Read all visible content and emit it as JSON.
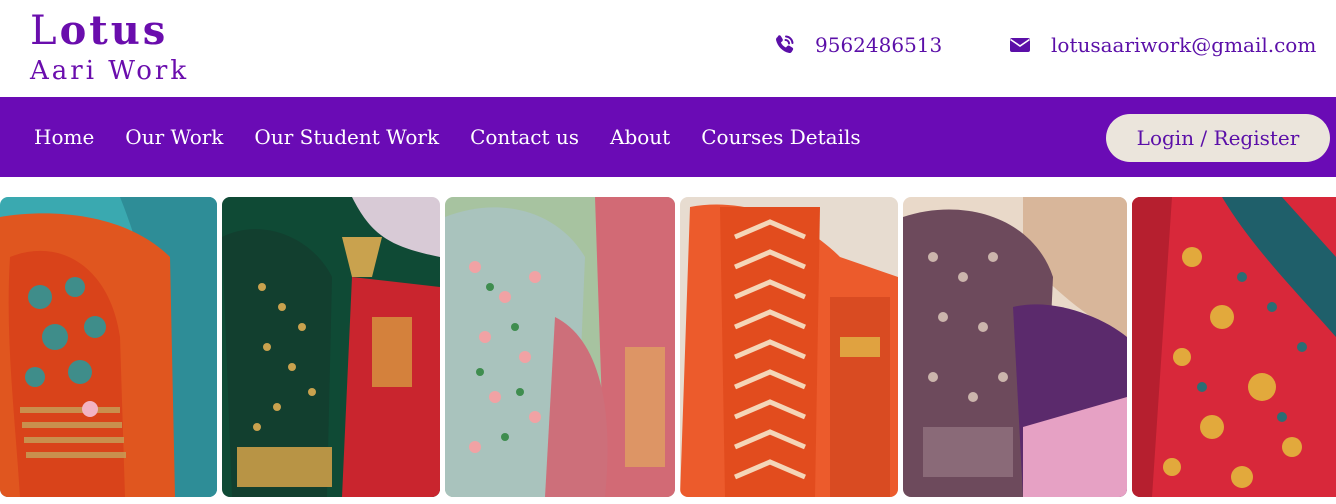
{
  "brand": {
    "initial": "L",
    "rest": "otus",
    "subtitle": "Aari Work"
  },
  "contact": {
    "phone": "9562486513",
    "email": "lotusaariwork@gmail.com",
    "phone_icon": "phone-icon",
    "email_icon": "envelope-icon"
  },
  "nav": {
    "items": [
      "Home",
      "Our Work",
      "Our Student Work",
      "Contact us",
      "About",
      "Courses Details"
    ],
    "login_label": "Login / Register"
  },
  "gallery": {
    "images": [
      "embroidered-blouse-orange-teal",
      "embroidered-blouse-green-red",
      "embroidered-blouse-mint-pink",
      "embroidered-blouse-orange-beads",
      "embroidered-blouse-purple-lace",
      "embroidered-blouse-red-gold"
    ]
  },
  "colors": {
    "brand": "#6a0dad",
    "navbar": "#6a0bb5",
    "button_bg": "#ebe5dc"
  }
}
